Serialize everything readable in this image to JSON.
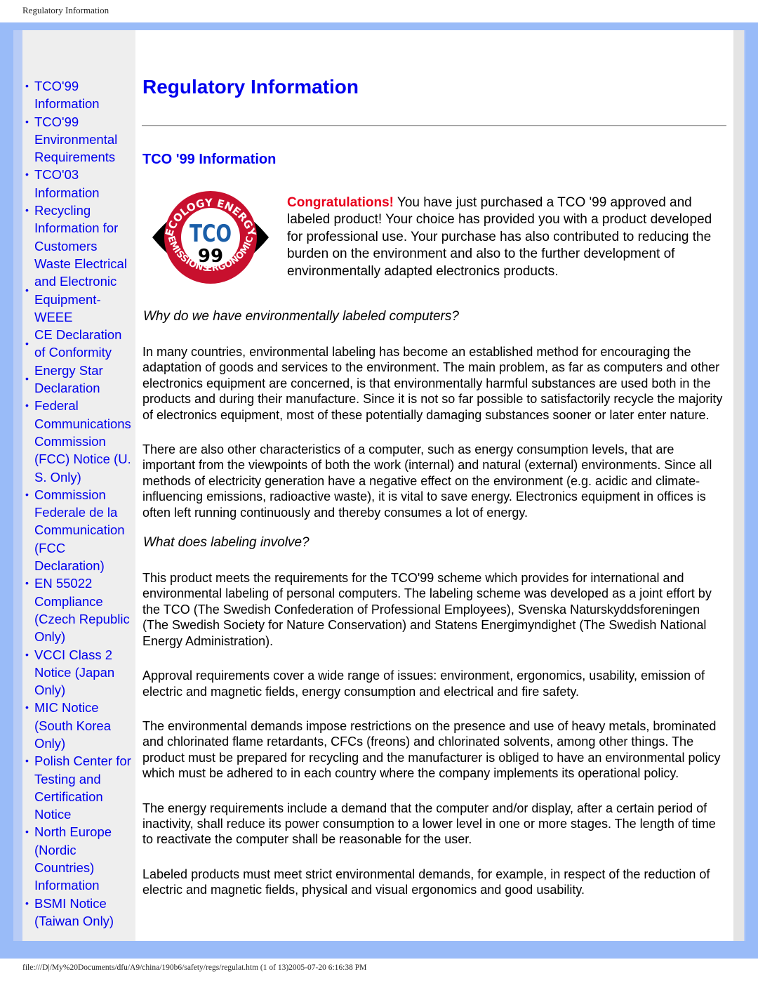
{
  "window_title": "Regulatory Information",
  "sidebar": {
    "items": [
      {
        "label": "TCO'99 Information"
      },
      {
        "label": "TCO'99 Environmental Requirements"
      },
      {
        "label": "TCO'03 Information"
      },
      {
        "label": "Recycling Information for Customers"
      },
      {
        "label": "Waste Electrical and Electronic Equipment-WEEE"
      },
      {
        "label": "CE Declaration of Conformity"
      },
      {
        "label": "Energy Star Declaration"
      },
      {
        "label": "Federal Communications Commission (FCC) Notice (U. S. Only)"
      },
      {
        "label": "Commission Federale de la Communication (FCC Declaration)"
      },
      {
        "label": "EN 55022 Compliance (Czech Republic Only)"
      },
      {
        "label": "VCCI Class 2 Notice (Japan Only)"
      },
      {
        "label": "MIC Notice (South Korea Only)"
      },
      {
        "label": "Polish Center for Testing and Certification Notice"
      },
      {
        "label": "North Europe (Nordic Countries) Information"
      },
      {
        "label": "BSMI Notice (Taiwan Only)"
      }
    ]
  },
  "main": {
    "title": "Regulatory Information",
    "section_title": "TCO '99 Information",
    "logo": {
      "top": "ECOLOGY ENERGY",
      "left": "EMISSIONS",
      "right": "ERGONOMICS",
      "center": "TCO",
      "number": "99"
    },
    "congrats": "Congratulations!",
    "intro": " You have just purchased a TCO '99 approved and labeled product! Your choice has provided you with a product developed for professional use. Your purchase has also contributed to reducing the burden on the environment and also to the further development of environmentally adapted electronics products.",
    "q1": "Why do we have environmentally labeled computers?",
    "p1": "In many countries, environmental labeling has become an established method for encouraging the adaptation of goods and services to the environment. The main problem, as far as computers and other electronics equipment are concerned, is that environmentally harmful substances are used both in the products and during their manufacture. Since it is not so far possible to satisfactorily recycle the majority of electronics equipment, most of these potentially damaging substances sooner or later enter nature.",
    "p2": "There are also other characteristics of a computer, such as energy consumption levels, that are important from the viewpoints of both the work (internal) and natural (external) environments. Since all methods of electricity generation have a negative effect on the environment (e.g. acidic and climate-influencing emissions, radioactive waste), it is vital to save energy. Electronics equipment in offices is often left running continuously and thereby consumes a lot of energy.",
    "q2": "What does labeling involve?",
    "p3": "This product meets the requirements for the TCO'99 scheme which provides for international and environmental labeling of personal computers. The labeling scheme was developed as a joint effort by the TCO (The Swedish Confederation of Professional Employees), Svenska Naturskyddsforeningen (The Swedish Society for Nature Conservation) and Statens Energimyndighet (The Swedish National Energy Administration).",
    "p4": "Approval requirements cover a wide range of issues: environment, ergonomics, usability, emission of electric and magnetic fields, energy consumption and electrical and fire safety.",
    "p5": "The environmental demands impose restrictions on the presence and use of heavy metals, brominated and chlorinated flame retardants, CFCs (freons) and chlorinated solvents, among other things. The product must be prepared for recycling and the manufacturer is obliged to have an environmental policy which must be adhered to in each country where the company implements its operational policy.",
    "p6": "The energy requirements include a demand that the computer and/or display, after a certain period of inactivity, shall reduce its power consumption to a lower level in one or more stages. The length of time to reactivate the computer shall be reasonable for the user.",
    "p7": "Labeled products must meet strict environmental demands, for example, in respect of the reduction of electric and magnetic fields, physical and visual ergonomics and good usability."
  },
  "footer": "file:///D|/My%20Documents/dfu/A9/china/190b6/safety/regs/regulat.htm (1 of 13)2005-07-20 6:16:38 PM",
  "colors": {
    "link": "#0000ee",
    "accent_red": "#e8001c",
    "background_blue": "#99bbf8",
    "sidebar_gray": "#eeeeee"
  }
}
